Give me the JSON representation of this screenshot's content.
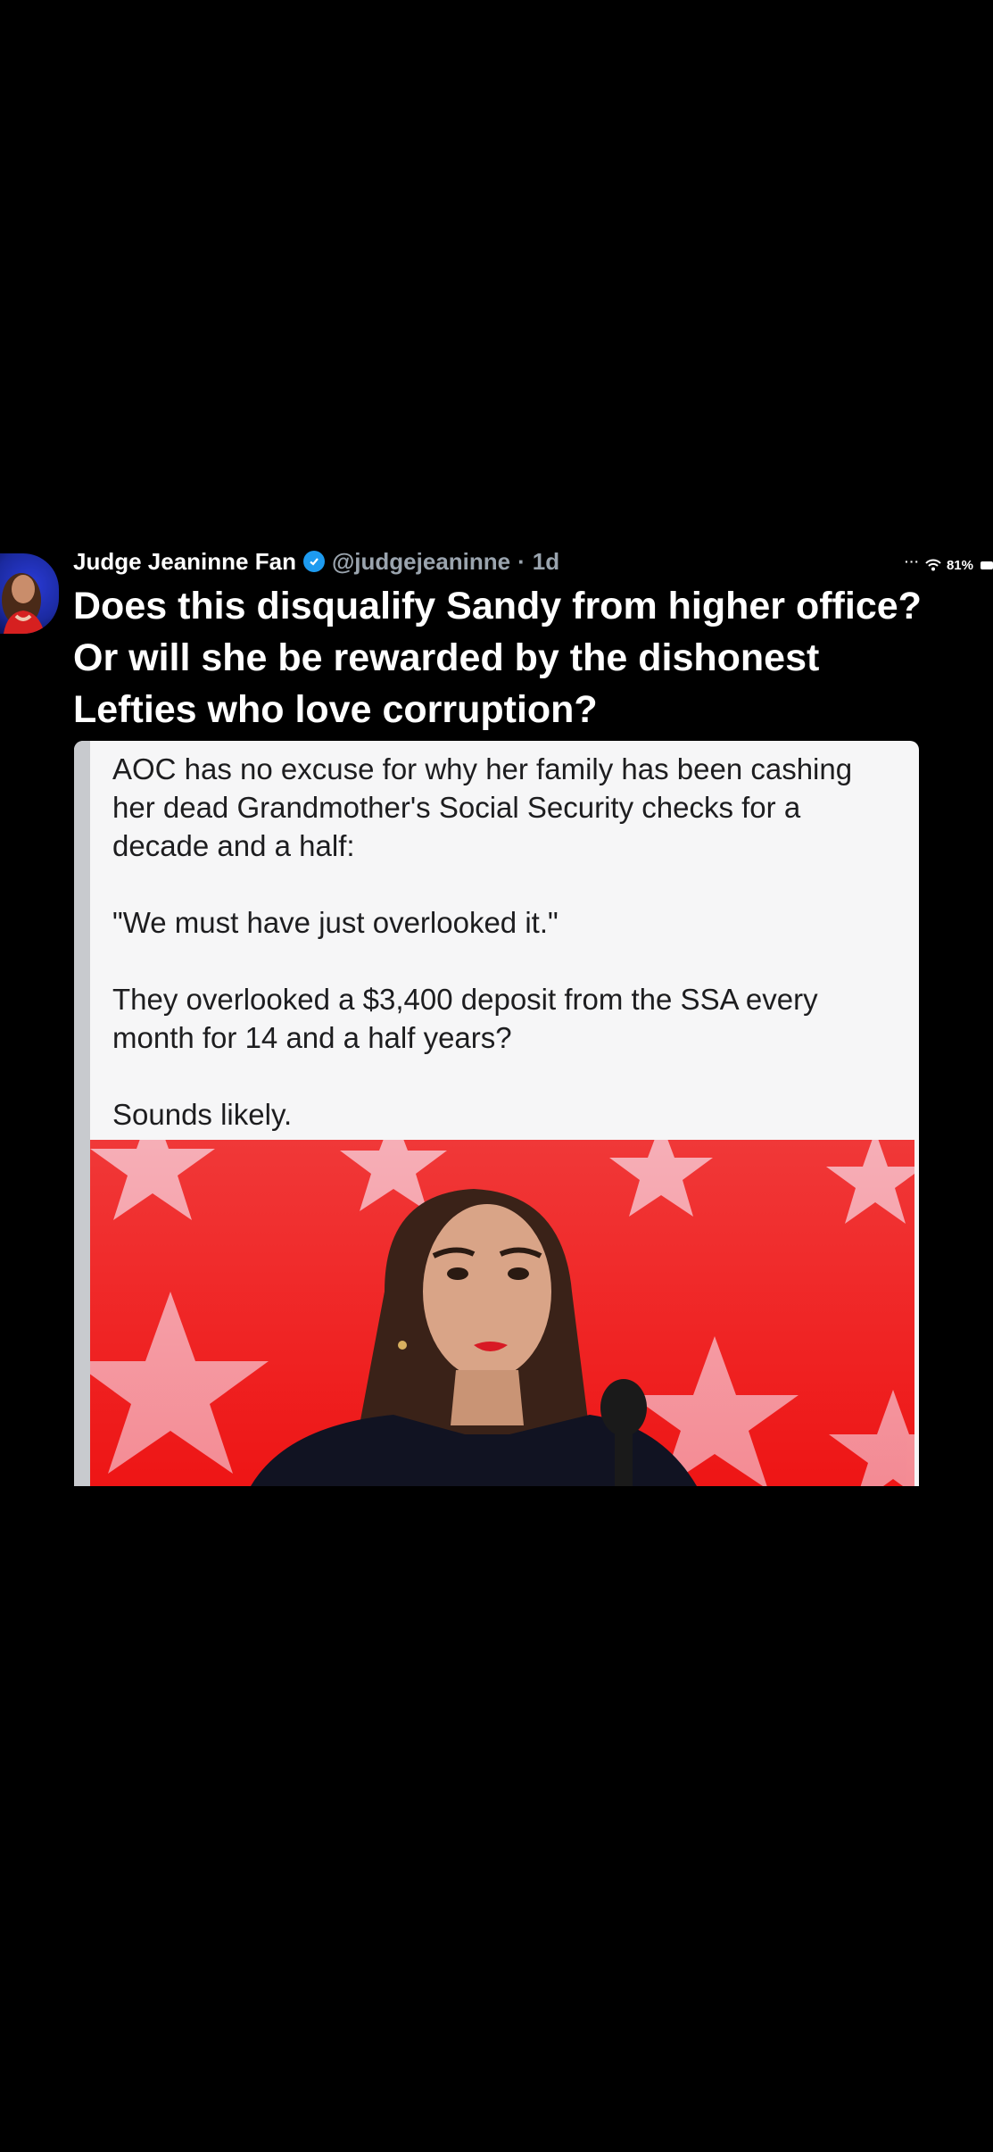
{
  "status_bar": {
    "dots": "···",
    "battery_text": "81%"
  },
  "tweet": {
    "author_name": "Judge Jeaninne Fan",
    "handle": "@judgejeaninne",
    "separator": "·",
    "time": "1d",
    "text": "Does this disqualify Sandy from higher office? Or will she be rewarded by the dishonest Lefties who love corruption?"
  },
  "quoted_post": {
    "paragraphs": [
      "AOC has no excuse for why her family has been cashing her dead Grandmother's Social Security checks for a decade and a half:",
      "\"We must have just overlooked it.\"",
      "They overlooked a $3,400 deposit from the SSA every month for 14 and a half years?",
      "Sounds likely."
    ]
  },
  "icons": {
    "verified": "verified-badge-icon",
    "wifi": "wifi-icon",
    "battery": "battery-icon"
  },
  "colors": {
    "background": "#000000",
    "verified": "#1d9bf0",
    "handle": "#9aa4ae",
    "photo_red": "#ee1515"
  }
}
